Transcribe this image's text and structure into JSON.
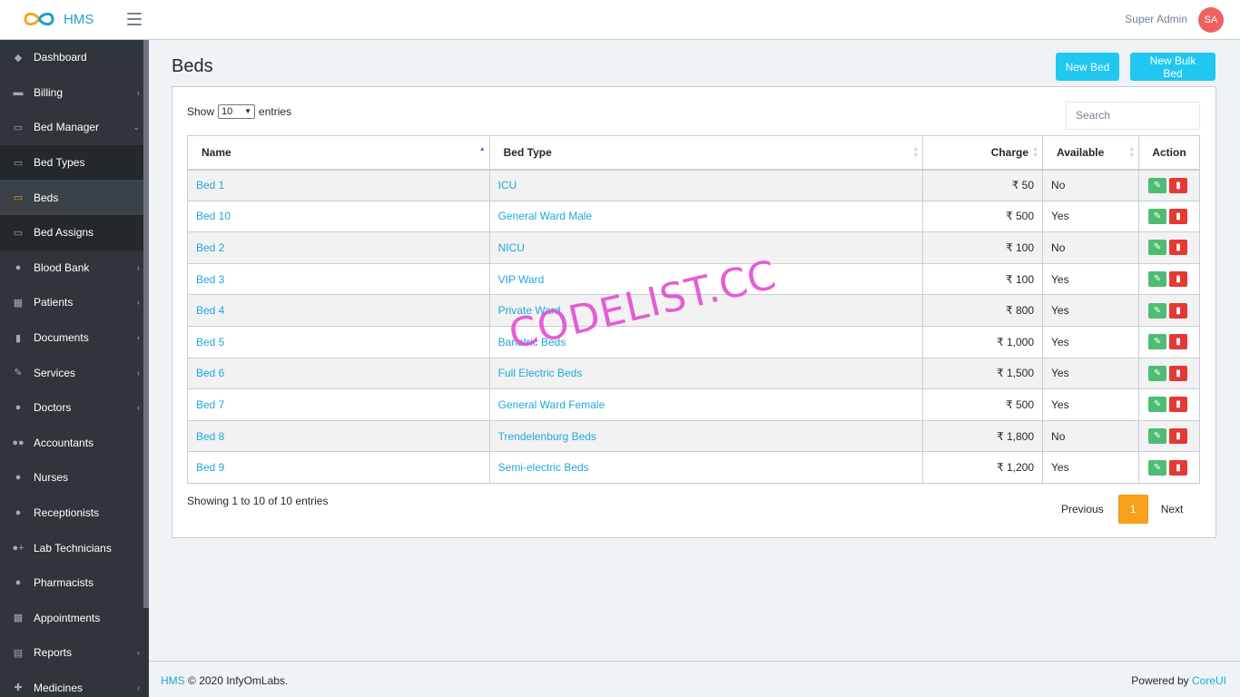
{
  "header": {
    "brand": "HMS",
    "user_name": "Super Admin",
    "avatar_initials": "SA"
  },
  "sidebar": {
    "items": [
      {
        "label": "Dashboard",
        "icon": "dashboard-icon"
      },
      {
        "label": "Billing",
        "icon": "billing-icon"
      },
      {
        "label": "Bed Manager",
        "icon": "bed-icon"
      },
      {
        "label": "Bed Types",
        "icon": "bed-icon"
      },
      {
        "label": "Beds",
        "icon": "bed-icon"
      },
      {
        "label": "Bed Assigns",
        "icon": "bed-icon"
      },
      {
        "label": "Blood Bank",
        "icon": "blood-drop-icon"
      },
      {
        "label": "Patients",
        "icon": "patients-icon"
      },
      {
        "label": "Documents",
        "icon": "document-icon"
      },
      {
        "label": "Services",
        "icon": "wrench-icon"
      },
      {
        "label": "Doctors",
        "icon": "user-icon"
      },
      {
        "label": "Accountants",
        "icon": "users-icon"
      },
      {
        "label": "Nurses",
        "icon": "user-icon"
      },
      {
        "label": "Receptionists",
        "icon": "user-icon"
      },
      {
        "label": "Lab Technicians",
        "icon": "user-plus-icon"
      },
      {
        "label": "Pharmacists",
        "icon": "user-icon"
      },
      {
        "label": "Appointments",
        "icon": "calendar-icon"
      },
      {
        "label": "Reports",
        "icon": "report-icon"
      },
      {
        "label": "Medicines",
        "icon": "medicine-icon"
      }
    ]
  },
  "page": {
    "title": "Beds",
    "new_bed_label": "New Bed",
    "new_bulk_bed_label": "New Bulk Bed",
    "show_label": "Show",
    "entries_label": "entries",
    "page_size": "10",
    "search_placeholder": "Search",
    "showing_text": "Showing 1 to 10 of 10 entries",
    "prev_label": "Previous",
    "next_label": "Next",
    "current_page": "1"
  },
  "table": {
    "headers": [
      "Name",
      "Bed Type",
      "Charge",
      "Available",
      "Action"
    ],
    "rows": [
      {
        "name": "Bed 1",
        "type": "ICU",
        "charge": "₹ 50",
        "available": "No"
      },
      {
        "name": "Bed 10",
        "type": "General Ward Male",
        "charge": "₹ 500",
        "available": "Yes"
      },
      {
        "name": "Bed 2",
        "type": "NICU",
        "charge": "₹ 100",
        "available": "No"
      },
      {
        "name": "Bed 3",
        "type": "VIP Ward",
        "charge": "₹ 100",
        "available": "Yes"
      },
      {
        "name": "Bed 4",
        "type": "Private Ward",
        "charge": "₹ 800",
        "available": "Yes"
      },
      {
        "name": "Bed 5",
        "type": "Bariatric Beds",
        "charge": "₹ 1,000",
        "available": "Yes"
      },
      {
        "name": "Bed 6",
        "type": "Full Electric Beds",
        "charge": "₹ 1,500",
        "available": "Yes"
      },
      {
        "name": "Bed 7",
        "type": "General Ward Female",
        "charge": "₹ 500",
        "available": "Yes"
      },
      {
        "name": "Bed 8",
        "type": "Trendelenburg Beds",
        "charge": "₹ 1,800",
        "available": "No"
      },
      {
        "name": "Bed 9",
        "type": "Semi-electric Beds",
        "charge": "₹ 1,200",
        "available": "Yes"
      }
    ]
  },
  "watermark": "CODELIST.CC",
  "footer": {
    "left_link": "HMS",
    "left_text": "© 2020 InfyOmLabs.",
    "right_text": "Powered by",
    "right_link": "CoreUI"
  }
}
